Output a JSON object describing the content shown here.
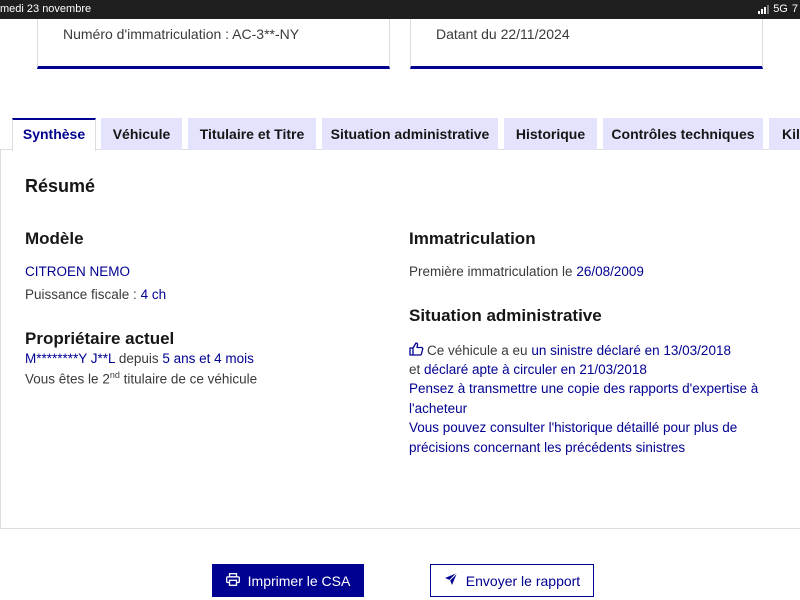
{
  "status_bar": {
    "date": "medi 23 novembre",
    "network": "5G",
    "extra": "7"
  },
  "cards": {
    "immatriculation": "Numéro d'immatriculation : AC-3**-NY",
    "datant": "Datant du 22/11/2024"
  },
  "tabs": [
    {
      "label": "Synthèse",
      "active": true
    },
    {
      "label": "Véhicule",
      "active": false
    },
    {
      "label": "Titulaire et Titre",
      "active": false
    },
    {
      "label": "Situation administrative",
      "active": false
    },
    {
      "label": "Historique",
      "active": false
    },
    {
      "label": "Contrôles techniques",
      "active": false
    },
    {
      "label": "Kil",
      "active": false
    }
  ],
  "summary": {
    "title": "Résumé",
    "modele": {
      "heading": "Modèle",
      "name": "CITROEN NEMO",
      "puissance_label": "Puissance fiscale : ",
      "puissance_value": "4 ch"
    },
    "proprietaire": {
      "heading": "Propriétaire actuel",
      "name": "M********Y J**L",
      "depuis_label": " depuis ",
      "depuis_value": "5 ans et 4 mois",
      "rank_prefix": "Vous êtes le ",
      "rank_number": "2",
      "rank_sup": "nd",
      "rank_suffix": " titulaire de ce véhicule"
    },
    "immatriculation": {
      "heading": "Immatriculation",
      "premiere_label": "Première immatriculation le ",
      "premiere_date": "26/08/2009"
    },
    "situation": {
      "heading": "Situation administrative",
      "line1_prefix": "Ce véhicule a eu ",
      "line1_link": "un sinistre déclaré en 13/03/2018",
      "line2_prefix": "et ",
      "line2_link": "déclaré apte à circuler en 21/03/2018",
      "line3": "Pensez à transmettre une copie des rapports d'expertise à",
      "line4": "l'acheteur",
      "line5": "Vous pouvez consulter l'historique détaillé pour plus de",
      "line6": "précisions concernant les précédents sinistres"
    }
  },
  "buttons": {
    "print": "Imprimer le CSA",
    "send": "Envoyer le rapport"
  },
  "colors": {
    "primary": "#000091",
    "tab_bg": "#e3e3fd",
    "text": "#161616",
    "muted": "#3a3a3a"
  }
}
